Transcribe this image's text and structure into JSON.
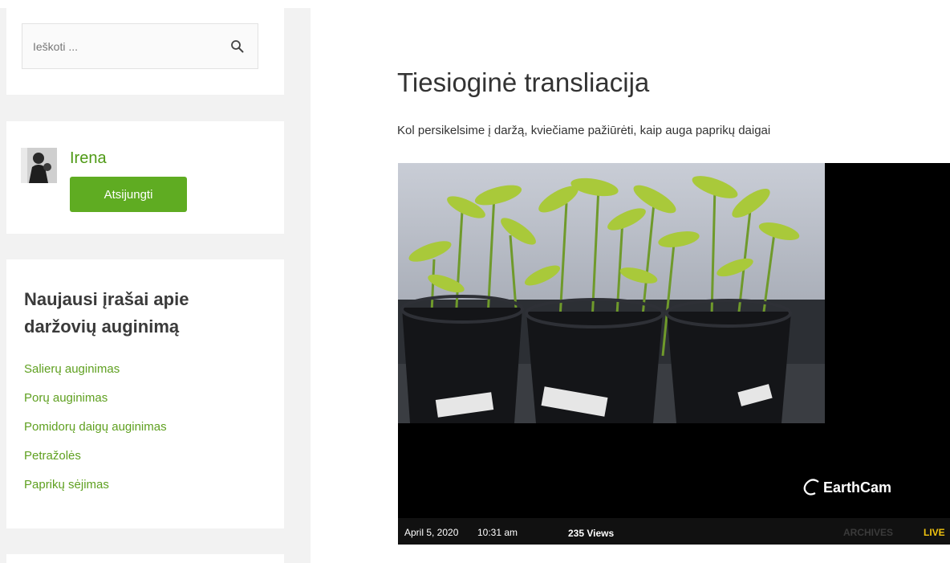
{
  "search": {
    "placeholder": "Ieškoti ..."
  },
  "user": {
    "name": "Irena",
    "logout_label": "Atsijungti"
  },
  "recent_posts": {
    "title": "Naujausi įrašai apie daržovių auginimą",
    "items": [
      {
        "label": "Salierų auginimas"
      },
      {
        "label": "Porų auginimas"
      },
      {
        "label": "Pomidorų daigų auginimas"
      },
      {
        "label": "Petražolės"
      },
      {
        "label": "Paprikų sėjimas"
      }
    ]
  },
  "main": {
    "title": "Tiesioginė transliacija",
    "intro": "Kol persikelsime į daržą, kviečiame pažiūrėti, kaip auga paprikų daigai"
  },
  "camera": {
    "logo": "EarthCam",
    "date": "April 5, 2020",
    "time": "10:31 am",
    "views": "235 Views",
    "archives_label": "ARCHIVES",
    "live_label": "LIVE"
  },
  "colors": {
    "accent": "#5fac22",
    "link": "#5fa020",
    "sidebar_bg": "#f2f2f2"
  }
}
